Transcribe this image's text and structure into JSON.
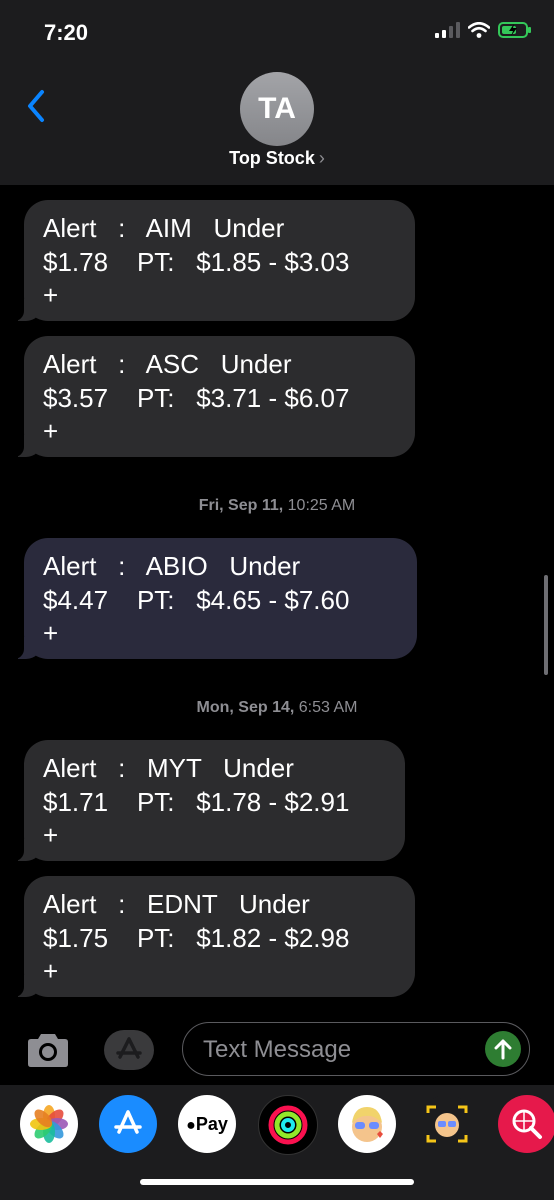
{
  "status_bar": {
    "time": "7:20"
  },
  "header": {
    "avatar_initials": "TA",
    "contact_name": "Top Stock",
    "chevron": "›"
  },
  "messages": [
    {
      "text": "Alert   :   AIM   Under\n$1.78    PT:   $1.85 - $3.03\n+"
    },
    {
      "text": "Alert   :   ASC   Under\n$3.57    PT:   $3.71 - $6.07\n+"
    },
    {
      "text": "Alert   :   ABIO   Under\n$4.47    PT:   $4.65 - $7.60\n+"
    },
    {
      "text": "Alert   :   MYT   Under\n$1.71    PT:   $1.78 - $2.91\n+"
    },
    {
      "text": "Alert   :   EDNT   Under\n$1.75    PT:   $1.82 - $2.98\n+"
    }
  ],
  "timestamps": [
    {
      "day": "Fri, Sep 11,",
      "time": "10:25 AM"
    },
    {
      "day": "Mon, Sep 14,",
      "time": "6:53 AM"
    }
  ],
  "composer": {
    "placeholder": "Text Message"
  },
  "app_drawer": {
    "apps": [
      "photos-icon",
      "app-store-icon",
      "apple-pay-icon",
      "activity-icon",
      "memoji-icon",
      "animoji-icon",
      "search-images-icon"
    ],
    "apple_pay_label": "Pay"
  },
  "colors": {
    "accent_blue": "#0a84ff",
    "bubble": "#2c2c2e",
    "send": "#2e7d32",
    "battery": "#34c759"
  }
}
